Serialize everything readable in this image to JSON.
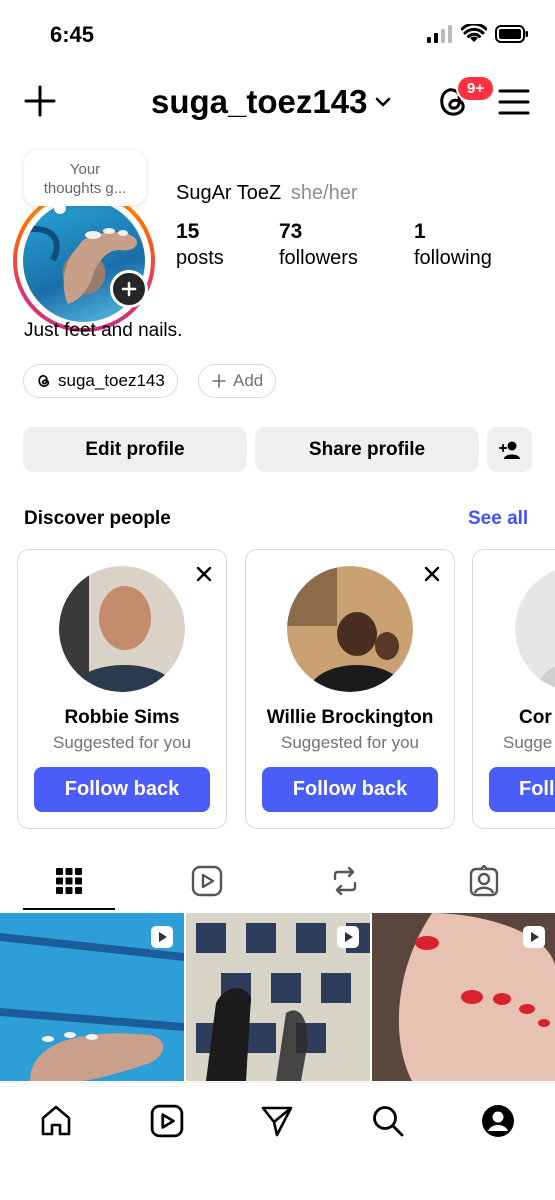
{
  "status_bar": {
    "time": "6:45"
  },
  "header": {
    "username": "suga_toez143",
    "notification_badge": "9+"
  },
  "note": {
    "text_line1": "Your",
    "text_line2": "thoughts g..."
  },
  "profile": {
    "display_name": "SugAr ToeZ",
    "pronouns": "she/her",
    "stats": [
      {
        "count": "15",
        "label": "posts"
      },
      {
        "count": "73",
        "label": "followers"
      },
      {
        "count": "1",
        "label": "following"
      }
    ],
    "bio": "Just feet and nails.",
    "threads_handle": "suga_toez143",
    "add_label": "Add"
  },
  "actions": {
    "edit_profile": "Edit profile",
    "share_profile": "Share profile"
  },
  "discover": {
    "title": "Discover people",
    "see_all": "See all",
    "cards": [
      {
        "name": "Robbie Sims",
        "subtitle": "Suggested for you",
        "button": "Follow back"
      },
      {
        "name": "Willie Brockington",
        "subtitle": "Suggested for you",
        "button": "Follow back"
      },
      {
        "name": "Cor",
        "subtitle": "Sugge",
        "button": "Foll"
      }
    ]
  },
  "tabs": [
    "grid-icon",
    "reels-icon",
    "reposts-icon",
    "tagged-icon"
  ],
  "bottom_nav": [
    "home-icon",
    "reels-icon",
    "messages-icon",
    "search-icon",
    "profile-icon"
  ],
  "colors": {
    "accent_blue": "#4a5df9",
    "link_blue": "#4150f7",
    "badge_red": "#ff3040"
  }
}
